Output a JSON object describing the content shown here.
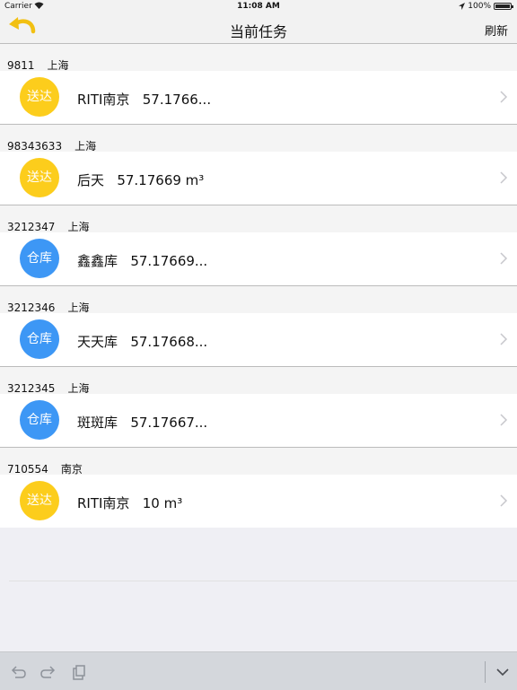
{
  "status": {
    "carrier": "Carrier",
    "time": "11:08 AM",
    "battery": "100%",
    "battery_level": 1.0
  },
  "nav": {
    "title": "当前任务",
    "refresh": "刷新"
  },
  "tasks": [
    {
      "id": "9811",
      "city": "上海",
      "badge": "送达",
      "badge_color": "#fccd1c",
      "name": "RITI南京",
      "volume": "57.1766..."
    },
    {
      "id": "98343633",
      "city": "上海",
      "badge": "送达",
      "badge_color": "#fccd1c",
      "name": "后天",
      "volume": "57.17669 m³"
    },
    {
      "id": "3212347",
      "city": "上海",
      "badge": "仓库",
      "badge_color": "#3d97f5",
      "name": "鑫鑫库",
      "volume": "57.17669..."
    },
    {
      "id": "3212346",
      "city": "上海",
      "badge": "仓库",
      "badge_color": "#3d97f5",
      "name": "天天库",
      "volume": "57.17668..."
    },
    {
      "id": "3212345",
      "city": "上海",
      "badge": "仓库",
      "badge_color": "#3d97f5",
      "name": "斑斑库",
      "volume": "57.17667..."
    },
    {
      "id": "710554",
      "city": "南京",
      "badge": "送达",
      "badge_color": "#fccd1c",
      "name": "RITI南京",
      "volume": "10 m³"
    }
  ],
  "colors": {
    "accent_yellow": "#fccd1c",
    "accent_blue": "#3d97f5"
  },
  "toolbar": {
    "icons": [
      "undo-icon",
      "redo-icon",
      "paste-icon",
      "chevron-down-icon"
    ]
  }
}
